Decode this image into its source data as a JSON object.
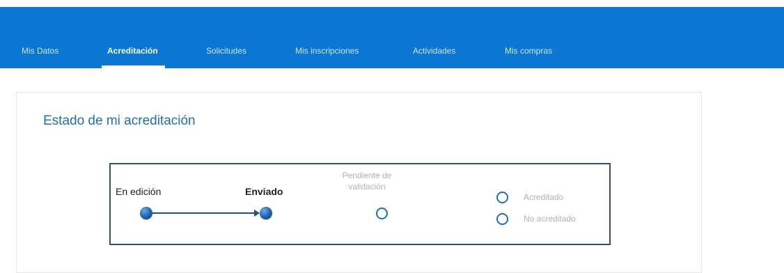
{
  "nav": {
    "items": [
      {
        "label": "Mis Datos",
        "active": false
      },
      {
        "label": "Acreditación",
        "active": true
      },
      {
        "label": "Solicitudes",
        "active": false
      },
      {
        "label": "Mis inscripciones",
        "active": false
      },
      {
        "label": "Actividades",
        "active": false
      },
      {
        "label": "Mis compras",
        "active": false
      }
    ]
  },
  "card": {
    "title": "Estado de mi acreditación"
  },
  "status": {
    "steps": {
      "edicion": "En edición",
      "enviado": "Enviado",
      "pendiente": "Pendiente de validación",
      "acreditado": "Acreditado",
      "no_acreditado": "No acreditado"
    },
    "completed": [
      "En edición",
      "Enviado"
    ]
  },
  "colors": {
    "header": "#0a78d2",
    "title": "#1c6fb7",
    "box_border": "#2f4f73",
    "pending_text": "#b2b2b2"
  }
}
